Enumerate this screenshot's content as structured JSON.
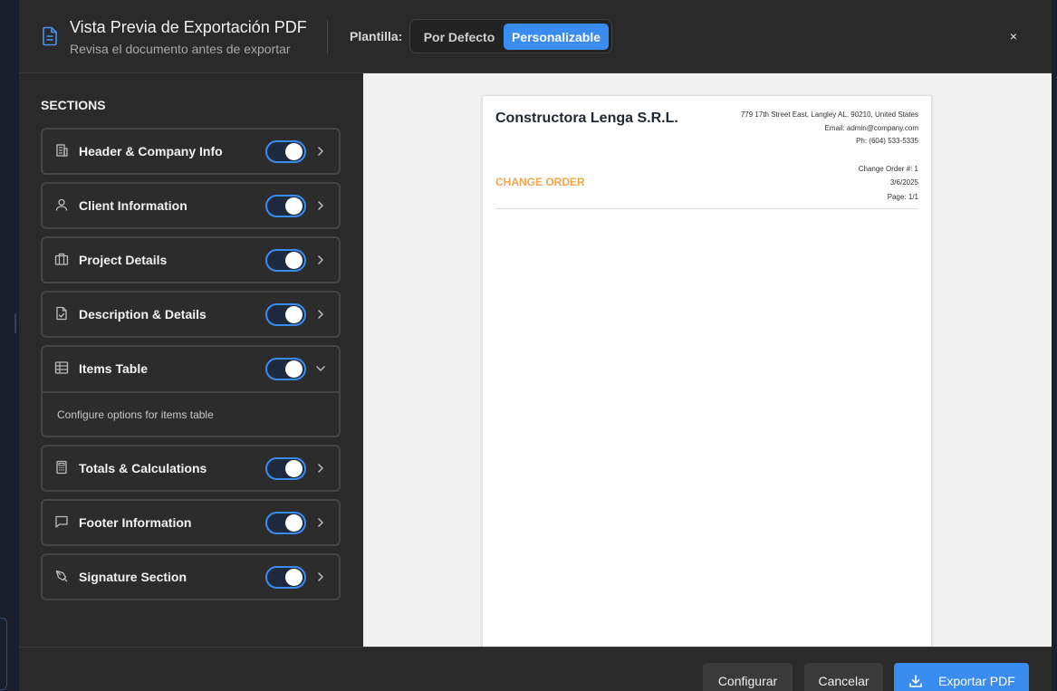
{
  "header": {
    "title": "Vista Previa de Exportación PDF",
    "subtitle": "Revisa el documento antes de exportar",
    "template_label": "Plantilla:",
    "template_options": [
      "Por Defecto",
      "Personalizable"
    ],
    "template_selected": "Personalizable",
    "close_label": "×"
  },
  "sidebar": {
    "title": "SECTIONS",
    "sections": [
      {
        "label": "Header & Company Info",
        "icon": "building-icon",
        "enabled": true,
        "expanded": false
      },
      {
        "label": "Client Information",
        "icon": "user-icon",
        "enabled": true,
        "expanded": false
      },
      {
        "label": "Project Details",
        "icon": "briefcase-icon",
        "enabled": true,
        "expanded": false
      },
      {
        "label": "Description & Details",
        "icon": "file-check-icon",
        "enabled": true,
        "expanded": false
      },
      {
        "label": "Items Table",
        "icon": "table-icon",
        "enabled": true,
        "expanded": true,
        "detail": "Configure options for items table"
      },
      {
        "label": "Totals & Calculations",
        "icon": "calculator-icon",
        "enabled": true,
        "expanded": false
      },
      {
        "label": "Footer Information",
        "icon": "message-icon",
        "enabled": true,
        "expanded": false
      },
      {
        "label": "Signature Section",
        "icon": "pen-icon",
        "enabled": true,
        "expanded": false
      }
    ]
  },
  "preview": {
    "company_name": "Constructora Lenga S.R.L.",
    "address": "779 17th Street East, Langley AL, 90210, United States",
    "email": "Email: admin@company.com",
    "phone": "Ph: (604) 533-5335",
    "doc_title": "CHANGE ORDER",
    "change_order": "Change Order #: 1",
    "date": "3/6/2025",
    "page": "Page: 1/1"
  },
  "footer": {
    "configure_label": "Configurar",
    "cancel_label": "Cancelar",
    "export_label": "Exportar PDF"
  },
  "colors": {
    "accent": "#3b8cf0",
    "doc_title": "#f3a64a",
    "modal_bg": "#2a2a2a",
    "preview_bg": "#f1f1f2"
  }
}
